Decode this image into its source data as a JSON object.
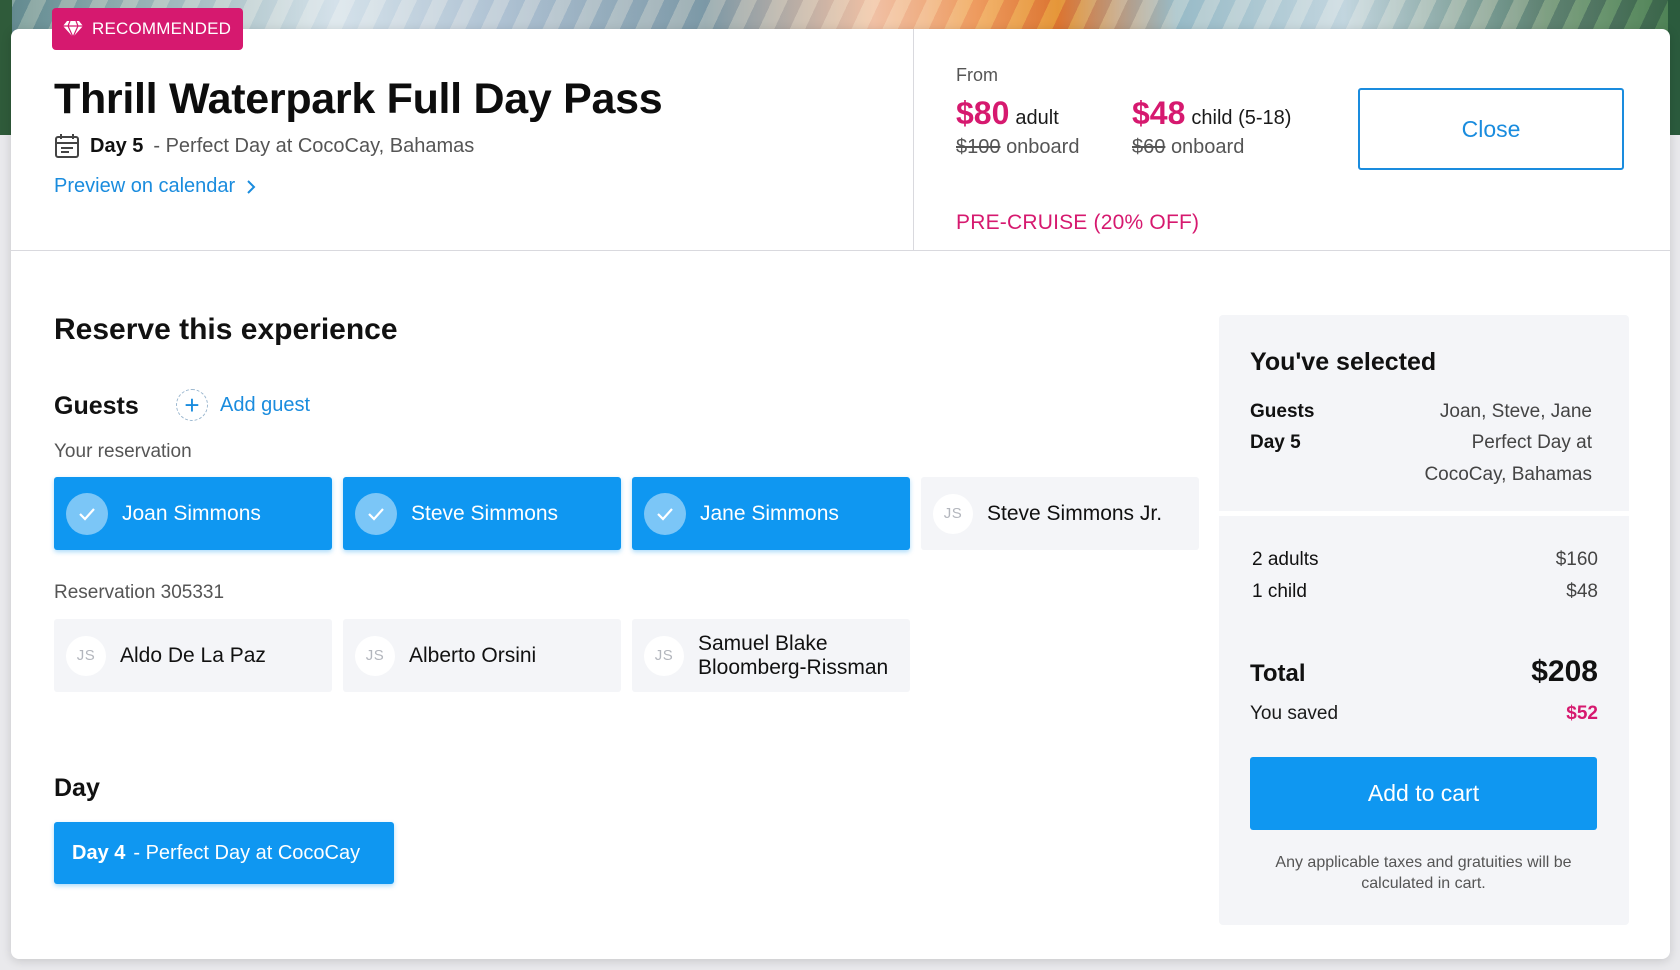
{
  "badge": {
    "label": "RECOMMENDED",
    "icon": "diamond-icon"
  },
  "header": {
    "title": "Thrill Waterpark Full Day Pass",
    "day_strong": "Day 5",
    "day_rest": "- Perfect Day at CocoCay, Bahamas",
    "preview_link": "Preview on calendar"
  },
  "pricing": {
    "from_label": "From",
    "adult": {
      "price": "$80",
      "unit": "adult",
      "onboard_price": "$100",
      "onboard_label": "onboard"
    },
    "child": {
      "price": "$48",
      "unit": "child (5-18)",
      "onboard_price": "$60",
      "onboard_label": "onboard"
    },
    "promo": "PRE-CRUISE (20% OFF)"
  },
  "close_label": "Close",
  "reserve": {
    "title": "Reserve this experience",
    "guests_label": "Guests",
    "add_guest_label": "Add guest",
    "your_reservation_label": "Your reservation",
    "your_guests": [
      {
        "name": "Joan Simmons",
        "selected": true
      },
      {
        "name": "Steve Simmons",
        "selected": true
      },
      {
        "name": "Jane Simmons",
        "selected": true
      },
      {
        "name": "Steve Simmons Jr.",
        "selected": false,
        "initials": "JS"
      }
    ],
    "other_reservation_label": "Reservation 305331",
    "other_guests": [
      {
        "name": "Aldo De La Paz",
        "initials": "JS"
      },
      {
        "name": "Alberto Orsini",
        "initials": "JS"
      },
      {
        "name_line1": "Samuel Blake",
        "name_line2": "Bloomberg-Rissman",
        "initials": "JS"
      }
    ],
    "day_label": "Day",
    "day_option": {
      "strong": "Day 4",
      "rest": "-  Perfect Day at CocoCay"
    }
  },
  "summary": {
    "title": "You've selected",
    "guests_key": "Guests",
    "guests_value": "Joan, Steve, Jane",
    "day_key": "Day 5",
    "day_value_line1": "Perfect Day at",
    "day_value_line2": "CocoCay, Bahamas",
    "lines": [
      {
        "label": "2 adults",
        "amount": "$160"
      },
      {
        "label": "1 child",
        "amount": "$48"
      }
    ],
    "total_label": "Total",
    "total_value": "$208",
    "saved_label": "You saved",
    "saved_value": "$52",
    "cart_button": "Add to cart",
    "tax_note": "Any applicable taxes and gratuities will be calculated in cart."
  },
  "colors": {
    "accent": "#0f97f1",
    "brand_pink": "#d6196f"
  }
}
